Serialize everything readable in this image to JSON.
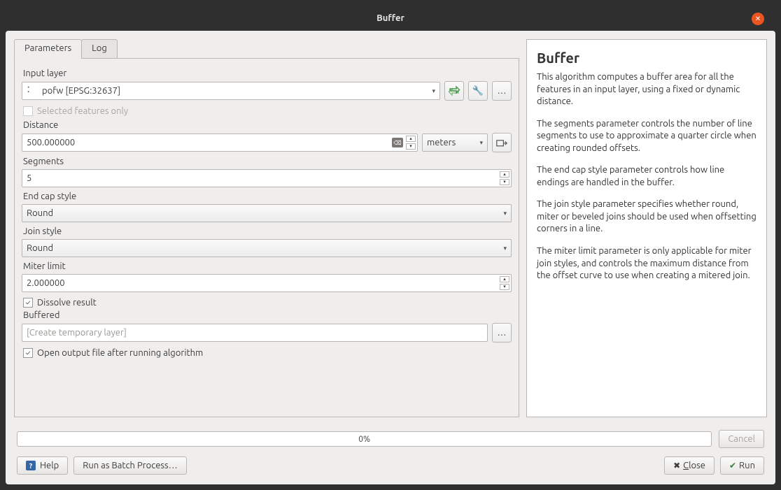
{
  "window_title": "Buffer",
  "tabs": {
    "parameters": "Parameters",
    "log": "Log"
  },
  "params": {
    "input_layer_label": "Input layer",
    "input_layer_value": "pofw [EPSG:32637]",
    "selected_only_label": "Selected features only",
    "selected_only_checked": false,
    "distance_label": "Distance",
    "distance_value": "500.000000",
    "distance_units": "meters",
    "segments_label": "Segments",
    "segments_value": "5",
    "end_cap_label": "End cap style",
    "end_cap_value": "Round",
    "join_style_label": "Join style",
    "join_style_value": "Round",
    "miter_limit_label": "Miter limit",
    "miter_limit_value": "2.000000",
    "dissolve_label": "Dissolve result",
    "dissolve_checked": true,
    "buffered_label": "Buffered",
    "buffered_placeholder": "[Create temporary layer]",
    "open_output_label": "Open output file after running algorithm",
    "open_output_checked": true
  },
  "help": {
    "title": "Buffer",
    "p1": "This algorithm computes a buffer area for all the features in an input layer, using a fixed or dynamic distance.",
    "p2": "The segments parameter controls the number of line segments to use to approximate a quarter circle when creating rounded offsets.",
    "p3": "The end cap style parameter controls how line endings are handled in the buffer.",
    "p4": "The join style parameter specifies whether round, miter or beveled joins should be used when offsetting corners in a line.",
    "p5": "The miter limit parameter is only applicable for miter join styles, and controls the maximum distance from the offset curve to use when creating a mitered join."
  },
  "progress_text": "0%",
  "buttons": {
    "cancel": "Cancel",
    "help": "Help",
    "batch": "Run as Batch Process…",
    "close": "lose",
    "close_mn": "C",
    "run": "Run"
  }
}
